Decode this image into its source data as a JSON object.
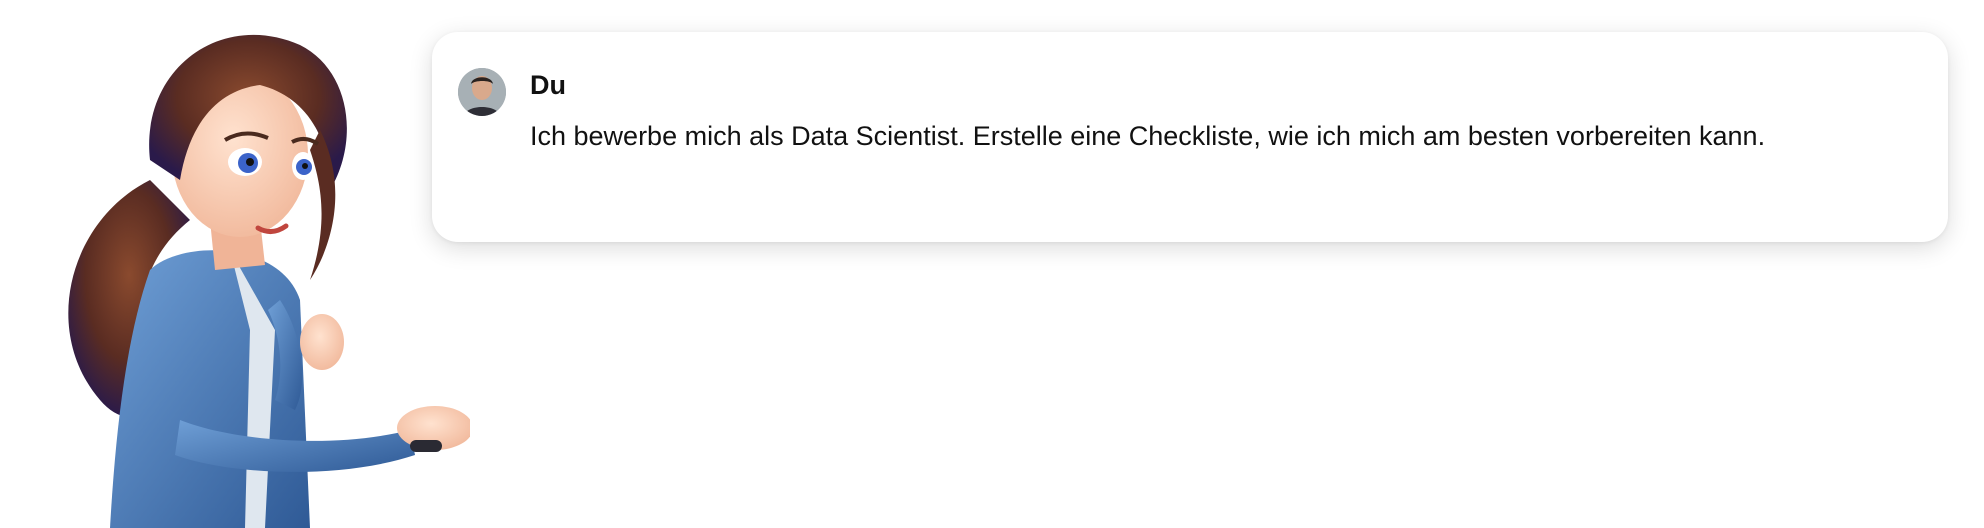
{
  "chat": {
    "sender_name": "Du",
    "message_text": "Ich bewerbe mich als Data Scientist. Erstelle eine Checkliste, wie ich mich am besten vorbereiten kann."
  },
  "icons": {
    "avatar": "user-avatar-photo",
    "illustration": "cartoon-woman-illustration"
  }
}
